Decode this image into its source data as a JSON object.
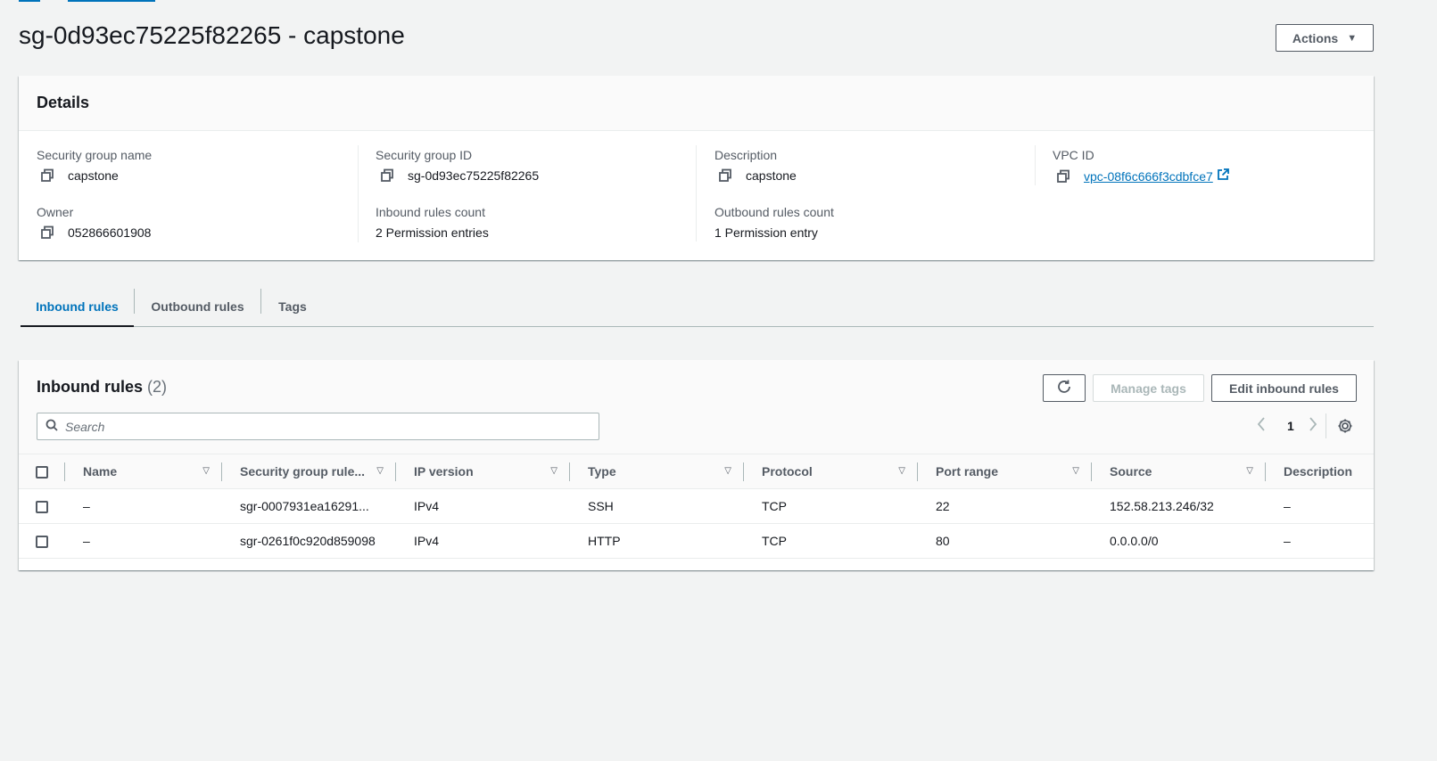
{
  "page_title": "sg-0d93ec75225f82265 - capstone",
  "actions_label": "Actions",
  "details": {
    "title": "Details",
    "sg_name_label": "Security group name",
    "sg_name_value": "capstone",
    "sg_id_label": "Security group ID",
    "sg_id_value": "sg-0d93ec75225f82265",
    "description_label": "Description",
    "description_value": "capstone",
    "vpc_label": "VPC ID",
    "vpc_value": "vpc-08f6c666f3cdbfce7",
    "owner_label": "Owner",
    "owner_value": "052866601908",
    "inbound_count_label": "Inbound rules count",
    "inbound_count_value": "2 Permission entries",
    "outbound_count_label": "Outbound rules count",
    "outbound_count_value": "1 Permission entry"
  },
  "tabs": [
    "Inbound rules",
    "Outbound rules",
    "Tags"
  ],
  "rules": {
    "title": "Inbound rules",
    "count": "(2)",
    "manage_tags_label": "Manage tags",
    "edit_label": "Edit inbound rules",
    "search_placeholder": "Search",
    "page": "1",
    "columns": [
      "Name",
      "Security group rule...",
      "IP version",
      "Type",
      "Protocol",
      "Port range",
      "Source",
      "Description"
    ],
    "rows": [
      [
        "–",
        "sgr-0007931ea16291...",
        "IPv4",
        "SSH",
        "TCP",
        "22",
        "152.58.213.246/32",
        "–"
      ],
      [
        "–",
        "sgr-0261f0c920d859098",
        "IPv4",
        "HTTP",
        "TCP",
        "80",
        "0.0.0.0/0",
        "–"
      ]
    ]
  },
  "colors": {
    "link": "#0073bb",
    "text": "#16191f",
    "muted": "#545b64",
    "background": "#f2f3f3"
  }
}
